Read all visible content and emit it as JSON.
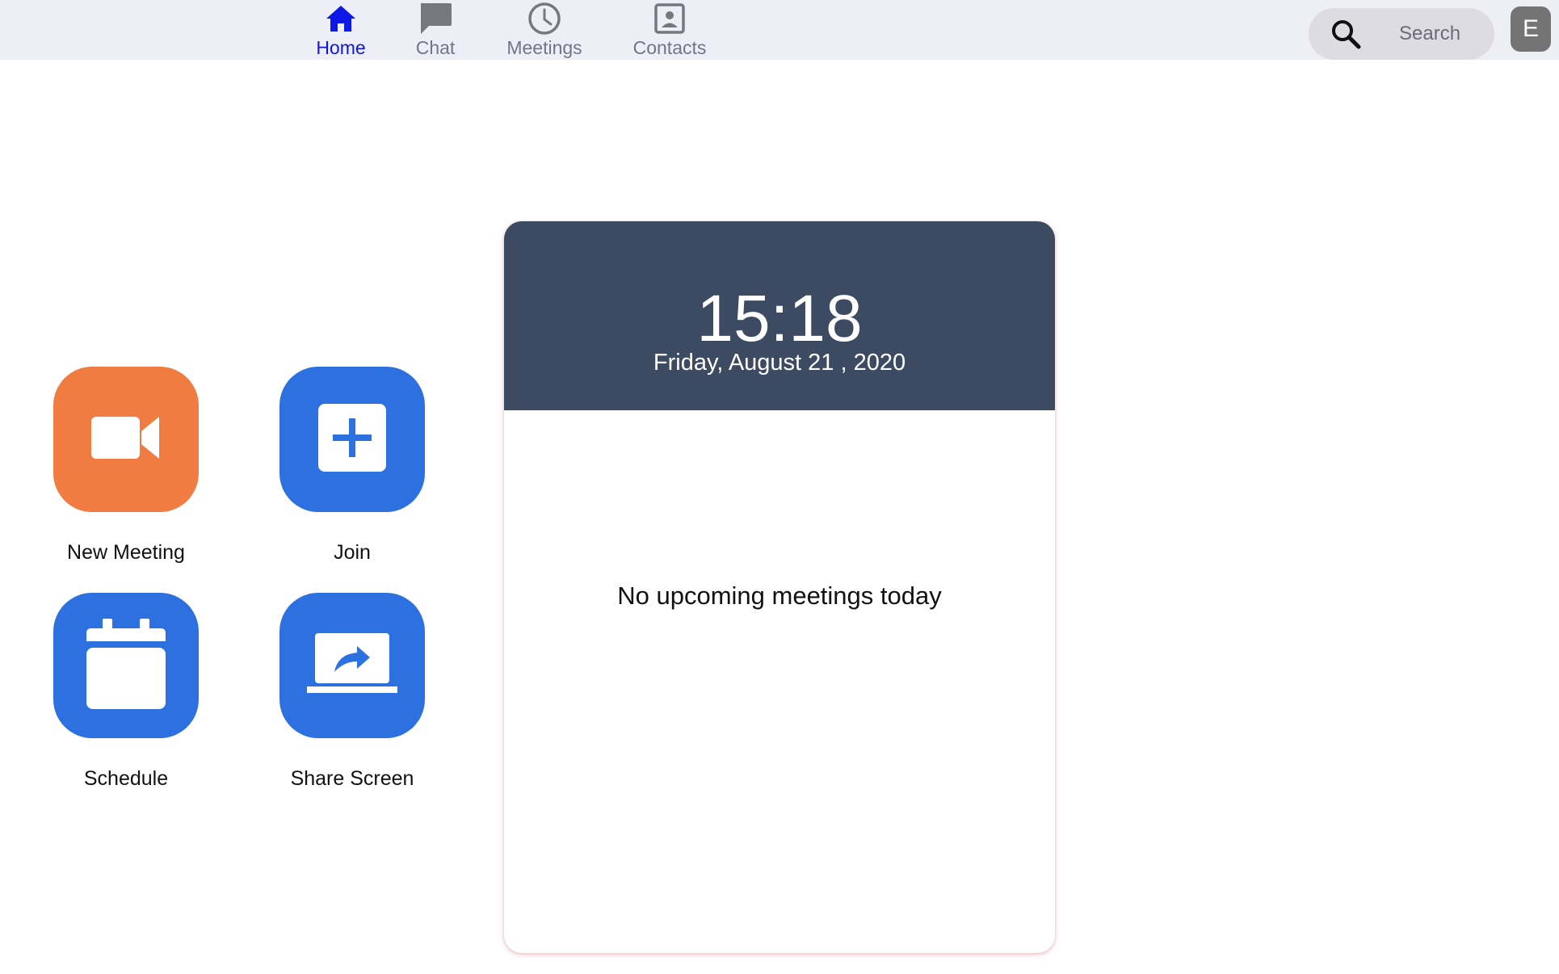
{
  "nav": {
    "tabs": [
      {
        "label": "Home",
        "icon": "home-icon",
        "active": true
      },
      {
        "label": "Chat",
        "icon": "chat-icon",
        "active": false
      },
      {
        "label": "Meetings",
        "icon": "clock-icon",
        "active": false
      },
      {
        "label": "Contacts",
        "icon": "contact-card-icon",
        "active": false
      }
    ],
    "active_color": "#0e17e6",
    "inactive_color": "#747487"
  },
  "search": {
    "placeholder": "Search",
    "icon": "search-icon"
  },
  "user": {
    "avatar_initial": "E",
    "avatar_color": "#747474"
  },
  "actions": [
    {
      "label": "New Meeting",
      "icon": "video-camera-icon",
      "color": "#f07c42"
    },
    {
      "label": "Join",
      "icon": "plus-icon",
      "color": "#2d71e0"
    },
    {
      "label": "Schedule",
      "icon": "calendar-icon",
      "color": "#2d71e0"
    },
    {
      "label": "Share Screen",
      "icon": "share-screen-icon",
      "color": "#2d71e0"
    }
  ],
  "clock": {
    "time": "15:18",
    "date": "Friday, August 21 , 2020",
    "header_color": "#3c4b61"
  },
  "meetings": {
    "empty_message": "No upcoming meetings today"
  }
}
